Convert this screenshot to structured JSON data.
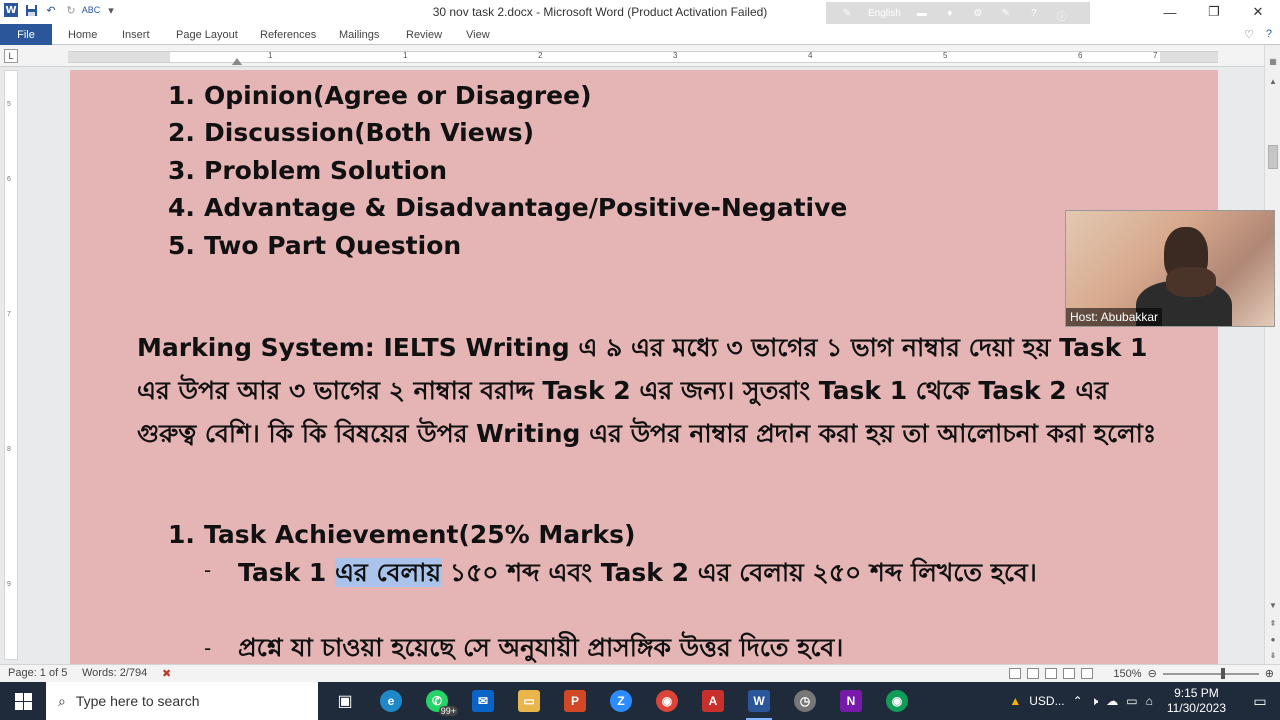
{
  "titlebar": {
    "title": "30 nov task 2.docx  -  Microsoft Word (Product Activation Failed)",
    "language": "English",
    "minimize": "—",
    "restore": "❐",
    "close": "✕"
  },
  "ribbon": {
    "tabs": [
      "File",
      "Home",
      "Insert",
      "Page Layout",
      "References",
      "Mailings",
      "Review",
      "View"
    ]
  },
  "ruler": {
    "numbers": [
      "1",
      "1",
      "2",
      "3",
      "4",
      "5",
      "6",
      "7"
    ]
  },
  "document": {
    "types_list": [
      {
        "num": "1.",
        "text": "Opinion(Agree or Disagree)"
      },
      {
        "num": "2.",
        "text": "Discussion(Both Views)"
      },
      {
        "num": "3.",
        "text": "Problem Solution"
      },
      {
        "num": "4.",
        "text": "Advantage & Disadvantage/Positive-Negative"
      },
      {
        "num": "5.",
        "text": "Two Part Question"
      }
    ],
    "marking_paragraph": "Marking System: IELTS Writing এ ৯ এর মধ্যে ৩ ভাগের ১ ভাগ নাম্বার দেয়া হয় Task 1 এর উপর আর ৩ ভাগের ২ নাম্বার বরাদ্দ Task 2 এর জন্য। সুতরাং Task 1 থেকে Task 2 এর গুরুত্ব বেশি। কি কি বিষয়ের উপর Writing এর উপর নাম্বার প্রদান করা হয় তা আলোচনা করা হলোঃ",
    "criteria": {
      "num": "1.",
      "text": "Task Achievement(25% Marks)"
    },
    "bullet1": {
      "dash": "-",
      "before": "Task 1 ",
      "selected": "এর বেলায়",
      "after": " ১৫০ শব্দ এবং Task 2 এর বেলায় ২৫০ শব্দ লিখতে হবে।"
    },
    "bullet2": {
      "dash": "-",
      "text": "প্রশ্নে যা চাওয়া হয়েছে সে অনুযায়ী প্রাসঙ্গিক উত্তর দিতে হবে।"
    }
  },
  "video": {
    "label": "Host: Abubakkar"
  },
  "statusbar": {
    "page": "Page: 1 of 5",
    "words": "Words: 2/794",
    "zoom": "150%"
  },
  "taskbar": {
    "search_placeholder": "Type here to search",
    "whatsapp_badge": "99+",
    "tray_usd": "USD...",
    "time": "9:15 PM",
    "date": "11/30/2023"
  }
}
